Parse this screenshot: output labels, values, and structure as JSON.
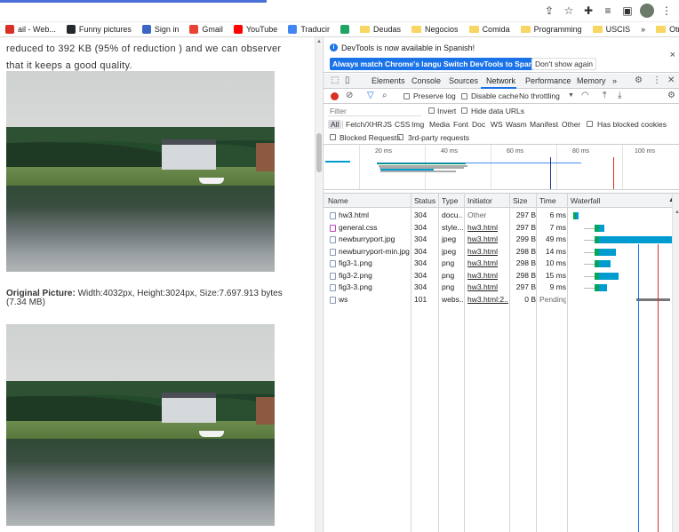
{
  "toolbar": {
    "share_icon": "share-icon",
    "star_icon": "star-icon",
    "extensions_icon": "puzzle-icon",
    "media_icon": "media-queue-icon",
    "split_icon": "side-panel-icon",
    "menu_icon": "kebab-menu-icon"
  },
  "bookmarks": [
    {
      "label": "ail - Web...",
      "icon": "mail",
      "color": "#d93025"
    },
    {
      "label": "Funny pictures",
      "icon": "github",
      "color": "#24292e"
    },
    {
      "label": "Sign in",
      "icon": "slack",
      "color": "#3b66c4"
    },
    {
      "label": "Gmail",
      "icon": "gmail",
      "color": "#ea4335"
    },
    {
      "label": "YouTube",
      "icon": "youtube",
      "color": "#ff0000"
    },
    {
      "label": "Traducir",
      "icon": "translate",
      "color": "#4285f4"
    },
    {
      "label": "",
      "icon": "drive",
      "color": "#1fa463"
    },
    {
      "label": "Deudas",
      "icon": "folder",
      "color": "#f9d564"
    },
    {
      "label": "Negocios",
      "icon": "folder",
      "color": "#f9d564"
    },
    {
      "label": "Comida",
      "icon": "folder",
      "color": "#f9d564"
    },
    {
      "label": "Programming",
      "icon": "folder",
      "color": "#f9d564"
    },
    {
      "label": "USCIS",
      "icon": "folder",
      "color": "#f9d564"
    }
  ],
  "bookmarks_overflow": "»",
  "bookmarks_other": "Otros marcadores",
  "page": {
    "paragraph": "reduced to 392 KB (95% of reduction ) and we can observer that it keeps a good quality.",
    "original_label": "Original Picture:",
    "original_text": " Width:4032px, Height:3024px, Size:7.697.913 bytes (7.34 MB)"
  },
  "devtools": {
    "infobar": {
      "message": "DevTools is now available in Spanish!",
      "btn_always": "Always match Chrome's language",
      "btn_switch": "Switch DevTools to Spanish",
      "btn_dont": "Don't show again",
      "close": "×"
    },
    "tabs": [
      "Elements",
      "Console",
      "Sources",
      "Network",
      "Performance",
      "Memory"
    ],
    "active_tab": "Network",
    "tabs_more": "»",
    "network_toolbar": {
      "preserve_log": "Preserve log",
      "disable_cache": "Disable cache",
      "throttling": "No throttling"
    },
    "filter": {
      "placeholder": "Filter",
      "invert": "Invert",
      "hide_data_urls": "Hide data URLs",
      "types": [
        "All",
        "Fetch/XHR",
        "JS",
        "CSS",
        "Img",
        "Media",
        "Font",
        "Doc",
        "WS",
        "Wasm",
        "Manifest",
        "Other"
      ],
      "has_blocked_cookies": "Has blocked cookies",
      "blocked_requests": "Blocked Requests",
      "third_party": "3rd-party requests"
    },
    "overview_ticks": [
      "20 ms",
      "40 ms",
      "60 ms",
      "80 ms",
      "100 ms"
    ],
    "columns": [
      "Name",
      "Status",
      "Type",
      "Initiator",
      "Size",
      "Time",
      "Waterfall"
    ],
    "requests": [
      {
        "name": "hw3.html",
        "status": "304",
        "type": "docu...",
        "initiator": "Other",
        "size": "297 B",
        "time": "6 ms",
        "wf_start": 0,
        "wf_wait": 2,
        "wf_dl": 1
      },
      {
        "name": "general.css",
        "status": "304",
        "type": "style...",
        "initiator": "hw3.html",
        "size": "297 B",
        "time": "7 ms",
        "wf_start": 15,
        "wf_wait": 3,
        "wf_dl": 2
      },
      {
        "name": "newburryport.jpg",
        "status": "304",
        "type": "jpeg",
        "initiator": "hw3.html",
        "size": "299 B",
        "time": "49 ms",
        "wf_start": 15,
        "wf_wait": 3,
        "wf_dl": 26
      },
      {
        "name": "newburryport-min.jpg",
        "status": "304",
        "type": "jpeg",
        "initiator": "hw3.html",
        "size": "298 B",
        "time": "14 ms",
        "wf_start": 15,
        "wf_wait": 3,
        "wf_dl": 6
      },
      {
        "name": "fig3-1.png",
        "status": "304",
        "type": "png",
        "initiator": "hw3.html",
        "size": "298 B",
        "time": "10 ms",
        "wf_start": 15,
        "wf_wait": 3,
        "wf_dl": 4
      },
      {
        "name": "fig3-2.png",
        "status": "304",
        "type": "png",
        "initiator": "hw3.html",
        "size": "298 B",
        "time": "15 ms",
        "wf_start": 15,
        "wf_wait": 3,
        "wf_dl": 7
      },
      {
        "name": "fig3-3.png",
        "status": "304",
        "type": "png",
        "initiator": "hw3.html",
        "size": "297 B",
        "time": "9 ms",
        "wf_start": 15,
        "wf_wait": 3,
        "wf_dl": 3
      },
      {
        "name": "ws",
        "status": "101",
        "type": "webs...",
        "initiator": "hw3.html:2...",
        "size": "0 B",
        "time": "Pending",
        "wf_start": 0,
        "wf_wait": 0,
        "wf_dl": 0
      }
    ],
    "colors": {
      "accent": "#1a73e8",
      "record": "#d93025",
      "wf_wait": "#00a65a",
      "wf_download": "#009ccf"
    }
  }
}
